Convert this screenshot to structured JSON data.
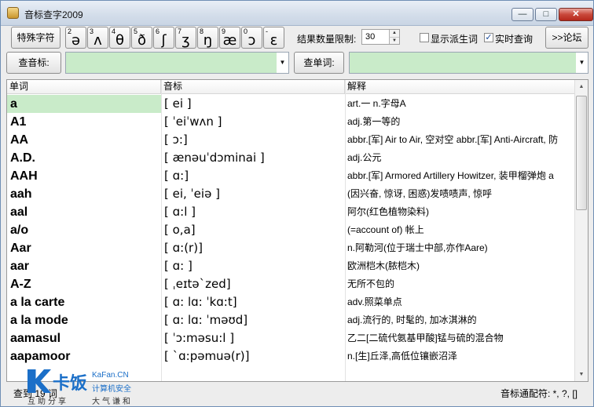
{
  "window": {
    "title": "音标查字2009",
    "min": "—",
    "max": "□",
    "close": "✕"
  },
  "toolbar": {
    "special_chars_label": "特殊字符",
    "symbols": [
      {
        "num": "2",
        "ch": "ə"
      },
      {
        "num": "3",
        "ch": "ʌ"
      },
      {
        "num": "4",
        "ch": "θ"
      },
      {
        "num": "5",
        "ch": "ð"
      },
      {
        "num": "6",
        "ch": "ʃ"
      },
      {
        "num": "7",
        "ch": "ʒ"
      },
      {
        "num": "8",
        "ch": "ŋ"
      },
      {
        "num": "9",
        "ch": "æ"
      },
      {
        "num": "0",
        "ch": "ɔ"
      },
      {
        "num": "-",
        "ch": "ɛ"
      }
    ],
    "result_limit_label": "结果数量限制:",
    "result_limit_value": "30",
    "show_derived_label": "显示派生词",
    "show_derived_checked": false,
    "realtime_label": "实时查询",
    "realtime_checked": true,
    "forum_label": ">>论坛"
  },
  "search": {
    "phonetic_button": "查音标:",
    "phonetic_value": "",
    "word_button": "查单词:",
    "word_value": ""
  },
  "table": {
    "headers": [
      "单词",
      "音标",
      "解释"
    ],
    "rows": [
      {
        "word": "a",
        "ipa": "[  ei ]",
        "def": "art.一  n.字母A"
      },
      {
        "word": "A1",
        "ipa": "[  ˈeiˈwʌn ]",
        "def": "adj.第一等的"
      },
      {
        "word": "AA",
        "ipa": "[ ɔ:]",
        "def": "abbr.[军] Air to Air, 空对空  abbr.[军] Anti-Aircraft, 防"
      },
      {
        "word": "A.D.",
        "ipa": "[  ænəuˈdɔminai ]",
        "def": "adj.公元"
      },
      {
        "word": "AAH",
        "ipa": "[ ɑ:]",
        "def": "abbr.[军] Armored Artillery Howitzer, 装甲榴弹炮  a"
      },
      {
        "word": "aah",
        "ipa": "[  ei, ˈeiə ]",
        "def": "(因兴奋, 惊讶, 困惑)发啧啧声, 惊呼"
      },
      {
        "word": "aal",
        "ipa": "[  ɑ:l ]",
        "def": "阿尔(红色植物染料)"
      },
      {
        "word": "a/o",
        "ipa": "[ o,a]",
        "def": "(=account of) 帐上"
      },
      {
        "word": "Aar",
        "ipa": "[ ɑ:(r)]",
        "def": "n.阿勒河(位于瑞士中部,亦作Aare)"
      },
      {
        "word": "aar",
        "ipa": "[  ɑ: ]",
        "def": "欧洲桤木(脓桤木)"
      },
      {
        "word": "A-Z",
        "ipa": "[ ˌeɪtəˋzed]",
        "def": "无所不包的"
      },
      {
        "word": "a la carte",
        "ipa": "[ ɑ: lɑ: ˈkɑ:t]",
        "def": "adv.照菜单点"
      },
      {
        "word": "a la mode",
        "ipa": "[ ɑ: lɑ: ˈməʊd]",
        "def": "adj.流行的, 时髦的, 加冰淇淋的"
      },
      {
        "word": "aamasul",
        "ipa": "[  ˈɔ:məsu:l ]",
        "def": "乙二[二硫代氨基甲酸]锰与硫的混合物"
      },
      {
        "word": "aapamoor",
        "ipa": "[ ˋɑ:pəmuə(r)]",
        "def": "n.[生]丘泽,高低位镶嵌沼泽"
      }
    ]
  },
  "status": {
    "left": "查到 19 词",
    "right": "音标通配符: *, ?, []"
  },
  "watermark": {
    "brand": "卡饭",
    "domain": "KaFan.CN",
    "tagline": "计算机安全",
    "slogan1": "互助分享",
    "slogan2": "大气谦和"
  }
}
